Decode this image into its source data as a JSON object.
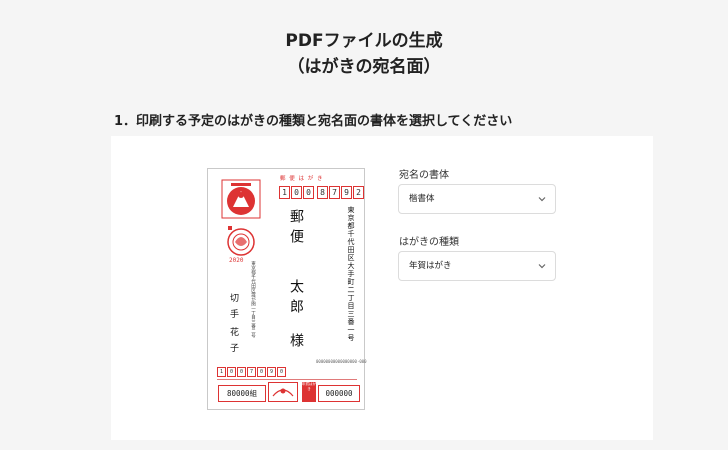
{
  "page": {
    "title_line1": "PDFファイルの生成",
    "title_line2": "（はがきの宛名面）",
    "section_heading": "1．印刷する予定のはがきの種類と宛名面の書体を選択してください"
  },
  "postcard": {
    "yubin_label": "郵 便 は が き",
    "zip_digits": [
      "1",
      "0",
      "0",
      "8",
      "7",
      "9",
      "2"
    ],
    "year_label": "2020",
    "recipient_address": "東京都千代田区大手町二丁目三番一号",
    "recipient_name_line1": "郵便",
    "recipient_name_line2": "太郎",
    "recipient_honorific": "様",
    "sender_address": "東京都千代田区霞が関一丁目三番二号",
    "sender_name_line1": "切手",
    "sender_name_line2": "花子",
    "barcode_dummy": "00000000000000000·000",
    "sender_zip_digits": [
      "1",
      "0",
      "0",
      "7",
      "0",
      "9",
      "0"
    ],
    "lottery_left": "80000組",
    "lottery_right": "000000",
    "lottery_badge": "年賀はがき"
  },
  "form": {
    "font_label": "宛名の書体",
    "font_value": "楷書体",
    "type_label": "はがきの種類",
    "type_value": "年賀はがき"
  },
  "colors": {
    "postal_red": "#dd3333",
    "background": "#f5f5f5",
    "card": "#ffffff"
  },
  "icons": {
    "stamp": "mouse-stamp-icon",
    "year": "mouse-2020-icon",
    "chevron": "chevron-down-icon"
  }
}
